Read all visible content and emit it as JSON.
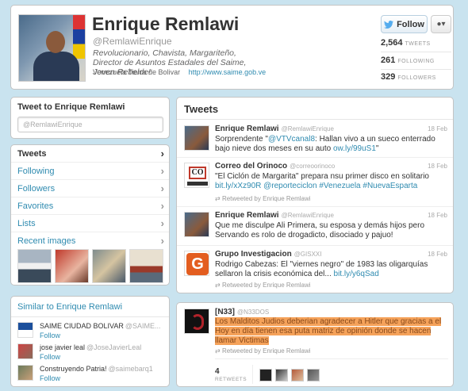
{
  "colors": {
    "page_bg": "#c9e3ef",
    "link": "#2f8bb0",
    "highlight": "#f5a25a"
  },
  "profile": {
    "name": "Enrique Remlawi",
    "handle": "@RemlawiEnrique",
    "bio": "Revolucionario, Chavista, Margariteño, Director de Asuntos Estadales del Saime, Joven Rebelde!",
    "location": "Venezuela Tierra de Bolivar",
    "url": "http://www.saime.gob.ve",
    "follow_label": "Follow",
    "user_menu_icon": "user-dropdown-icon",
    "stats": [
      {
        "value": "2,564",
        "label": "TWEETS"
      },
      {
        "value": "261",
        "label": "FOLLOWING"
      },
      {
        "value": "329",
        "label": "FOLLOWERS"
      }
    ]
  },
  "tweet_to": {
    "title": "Tweet to Enrique Remlawi",
    "placeholder": "@RemlawiEnrique"
  },
  "nav": {
    "items": [
      {
        "label": "Tweets",
        "active": true
      },
      {
        "label": "Following"
      },
      {
        "label": "Followers"
      },
      {
        "label": "Favorites"
      },
      {
        "label": "Lists"
      },
      {
        "label": "Recent images"
      }
    ]
  },
  "similar": {
    "title": "Similar to Enrique Remlawi",
    "follow_label": "Follow",
    "users": [
      {
        "name": "SAIME CIUDAD BOLIVAR",
        "handle": "@SAIME..."
      },
      {
        "name": "jose javier leal",
        "handle": "@JoseJavierLeal"
      },
      {
        "name": "Construyendo Patria!",
        "handle": "@saimebarq1"
      }
    ]
  },
  "tweets": {
    "title": "Tweets",
    "items": [
      {
        "name": "Enrique Remlawi",
        "handle": "@RemlawiEnrique",
        "date": "18 Feb",
        "text_a": "Sorprendente \"",
        "link_a": "@VTVcanal8",
        "text_b": ": Hallan vivo a un sueco enterrado bajo nieve dos meses en su auto ",
        "link_b": "ow.ly/99uS1",
        "text_c": "\""
      },
      {
        "name": "Correo del Orinoco",
        "handle": "@correoorinoco",
        "date": "18 Feb",
        "text_a": "\"El Ciclón de Margarita\" prepara nsu primer disco en solitario ",
        "link_a": "bit.ly/xXz90R",
        "link_b": "@reporteciclon",
        "link_c": "#Venezuela",
        "link_d": "#NuevaEsparta",
        "retweeted_by": "Retweeted by Enrique Remlawi"
      },
      {
        "name": "Enrique Remlawi",
        "handle": "@RemlawiEnrique",
        "date": "18 Feb",
        "text": "Que me disculpe Ali Primera, su esposa y demás hijos pero Servando es rolo de drogadicto, disociado y pajuo!"
      },
      {
        "name": "Grupo Investigacion",
        "handle": "@GISXXI",
        "date": "18 Feb",
        "text_a": "Rodrigo Cabezas: El \"viernes negro\" de 1983 las oligarquías sellaron la crisis económica del... ",
        "link_a": "bit.ly/y6qSad",
        "retweeted_by": "Retweeted by Enrique Remlawi"
      }
    ]
  },
  "expanded_tweet": {
    "name": "[N33]",
    "handle": "@N33DOS",
    "text": "Los Malditos Judios deberian agradecer a Hitler que gracias a el Hoy en día tienen esa puta matriz de opinión donde se hacen llamar Victimas",
    "retweeted_by": "Retweeted by Enrique Remlawi",
    "retweet_count": "4",
    "retweet_label": "RETWEETS"
  }
}
